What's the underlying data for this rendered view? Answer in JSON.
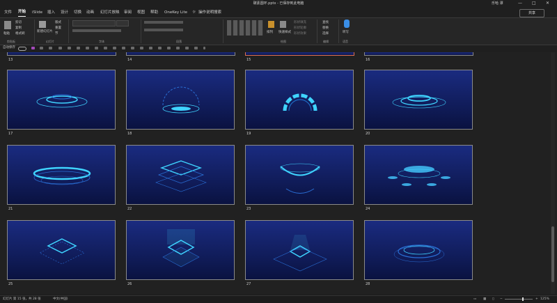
{
  "titlebar": {
    "title": "碳素圆环.pptx - 已保存到此电脑",
    "user": "乐哈 潭",
    "minimize": "—",
    "maximize": "□",
    "close": "✕"
  },
  "tabs": [
    "文件",
    "开始",
    "iSlide",
    "插入",
    "设计",
    "切换",
    "动画",
    "幻灯片放映",
    "审阅",
    "视图",
    "帮助",
    "OneKey Lite",
    "操作说明搜索"
  ],
  "share": "共享",
  "ribbon": {
    "paste": "粘贴",
    "cut": "剪切",
    "copy": "复制",
    "format_painter": "格式刷",
    "clipboard": "剪贴板",
    "new_slide": "新建幻灯片",
    "layout": "版式",
    "reset": "重置",
    "section": "节",
    "slides": "幻灯片",
    "font": "字体",
    "paragraph": "段落",
    "drawing": "绘图",
    "arrange": "排列",
    "quick_styles": "快速样式",
    "shape_fill": "形状填充",
    "shape_outline": "形状轮廓",
    "shape_effects": "形状效果",
    "find": "查找",
    "replace": "替换",
    "select": "选择",
    "editing": "编辑",
    "voice": "听写",
    "voice_group": "语音"
  },
  "quick_access": {
    "autosave": "自动保存"
  },
  "top_row_numbers": [
    "13",
    "14",
    "15",
    "16"
  ],
  "slides": [
    {
      "num": "17",
      "art": "ring-flat"
    },
    {
      "num": "18",
      "art": "dome"
    },
    {
      "num": "19",
      "art": "arc"
    },
    {
      "num": "20",
      "art": "disc-stack"
    },
    {
      "num": "21",
      "art": "platform-wide"
    },
    {
      "num": "22",
      "art": "layer-stack"
    },
    {
      "num": "23",
      "art": "bowl"
    },
    {
      "num": "24",
      "art": "disc-satellites"
    },
    {
      "num": "25",
      "art": "square-small"
    },
    {
      "num": "26",
      "art": "square-beam"
    },
    {
      "num": "27",
      "art": "square-glow"
    },
    {
      "num": "28",
      "art": "ring-outline"
    }
  ],
  "status": {
    "slide_info": "幻灯片 第 15 张，共 28 张",
    "language": "中文(中国)",
    "zoom": "125%"
  },
  "colors": {
    "accent": "#3fd4ff",
    "slide_bg": "#152275",
    "selection": "#e07050"
  }
}
